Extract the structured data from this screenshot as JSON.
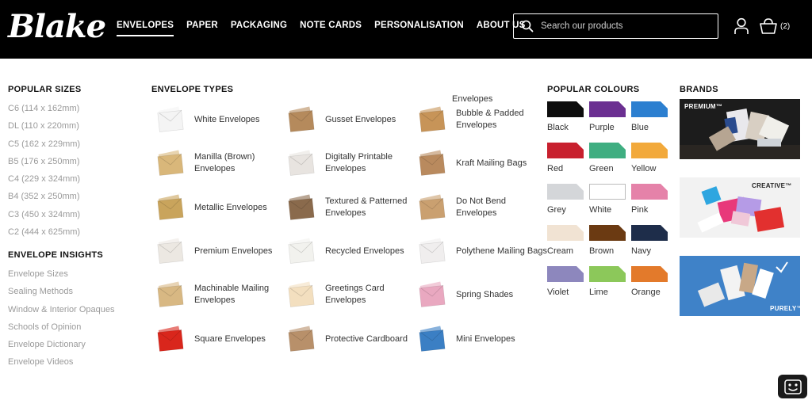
{
  "logo": "Blake",
  "nav": [
    "ENVELOPES",
    "PAPER",
    "PACKAGING",
    "NOTE CARDS",
    "PERSONALISATION",
    "ABOUT US"
  ],
  "search": {
    "placeholder": "Search our products"
  },
  "basket": {
    "count": "(2)"
  },
  "popular_sizes": {
    "heading": "POPULAR SIZES",
    "items": [
      "C6 (114 x 162mm)",
      "DL (110 x 220mm)",
      "C5 (162 x 229mm)",
      "B5 (176 x 250mm)",
      "C4 (229 x 324mm)",
      "B4 (352 x 250mm)",
      "C3 (450 x 324mm)",
      "C2 (444 x 625mm)"
    ]
  },
  "envelope_insights": {
    "heading": "ENVELOPE INSIGHTS",
    "items": [
      "Envelope Sizes",
      "Sealing Methods",
      "Window & Interior Opaques",
      "Schools of Opinion",
      "Envelope Dictionary",
      "Envelope Videos"
    ]
  },
  "envelope_types": {
    "heading": "ENVELOPE TYPES",
    "columns": [
      [
        {
          "label": "White Envelopes",
          "color": "#f4f4f4"
        },
        {
          "label": "Manilla (Brown) Envelopes",
          "color": "#d9b77a"
        },
        {
          "label": "Metallic Envelopes",
          "color": "#c9a45c"
        },
        {
          "label": "Premium Envelopes",
          "color": "#ece8e2"
        },
        {
          "label": "Machinable Mailing Envelopes",
          "color": "#d8b883"
        },
        {
          "label": "Square Envelopes",
          "color": "#d9261c"
        }
      ],
      [
        {
          "label": "Gusset Envelopes",
          "color": "#b58a5c"
        },
        {
          "label": "Digitally Printable Envelopes",
          "color": "#e8e4e0"
        },
        {
          "label": "Textured & Patterned Envelopes",
          "color": "#8a6a4c"
        },
        {
          "label": "Recycled Envelopes",
          "color": "#f2f2ee"
        },
        {
          "label": "Greetings Card Envelopes",
          "color": "#f3dfbf"
        },
        {
          "label": "Protective Cardboard",
          "color": "#b8906a"
        }
      ],
      [
        {
          "label": "Bubble & Padded Envelopes",
          "color": "#c79458"
        },
        {
          "label": "Kraft Mailing Bags",
          "color": "#b98a5e"
        },
        {
          "label": "Do Not Bend Envelopes",
          "color": "#caa070"
        },
        {
          "label": "Polythene Mailing Bags",
          "color": "#f0eeee"
        },
        {
          "label": "Spring Shades",
          "color": "#e9a8c0"
        },
        {
          "label": "Mini Envelopes",
          "color": "#3b7fc4"
        }
      ]
    ],
    "prefix_label": "Envelopes"
  },
  "popular_colours": {
    "heading": "POPULAR COLOURS",
    "items": [
      {
        "label": "Black",
        "color": "#0d0d0d"
      },
      {
        "label": "Purple",
        "color": "#6b2f91"
      },
      {
        "label": "Blue",
        "color": "#2c7fd0"
      },
      {
        "label": "Red",
        "color": "#c8202e"
      },
      {
        "label": "Green",
        "color": "#3fae81"
      },
      {
        "label": "Yellow",
        "color": "#f2a93b"
      },
      {
        "label": "Grey",
        "color": "#d4d6d9"
      },
      {
        "label": "White",
        "color": "#ffffff"
      },
      {
        "label": "Pink",
        "color": "#e582a9"
      },
      {
        "label": "Cream",
        "color": "#f1e3d3"
      },
      {
        "label": "Brown",
        "color": "#6b3a12"
      },
      {
        "label": "Navy",
        "color": "#1e2d4a"
      },
      {
        "label": "Violet",
        "color": "#8d87bd"
      },
      {
        "label": "Lime",
        "color": "#8cc85a"
      },
      {
        "label": "Orange",
        "color": "#e37a2b"
      }
    ]
  },
  "brands": {
    "heading": "BRANDS",
    "items": [
      {
        "label": "PREMIUM™"
      },
      {
        "label": "CREATIVE™"
      },
      {
        "label": "PURELY™"
      }
    ]
  }
}
